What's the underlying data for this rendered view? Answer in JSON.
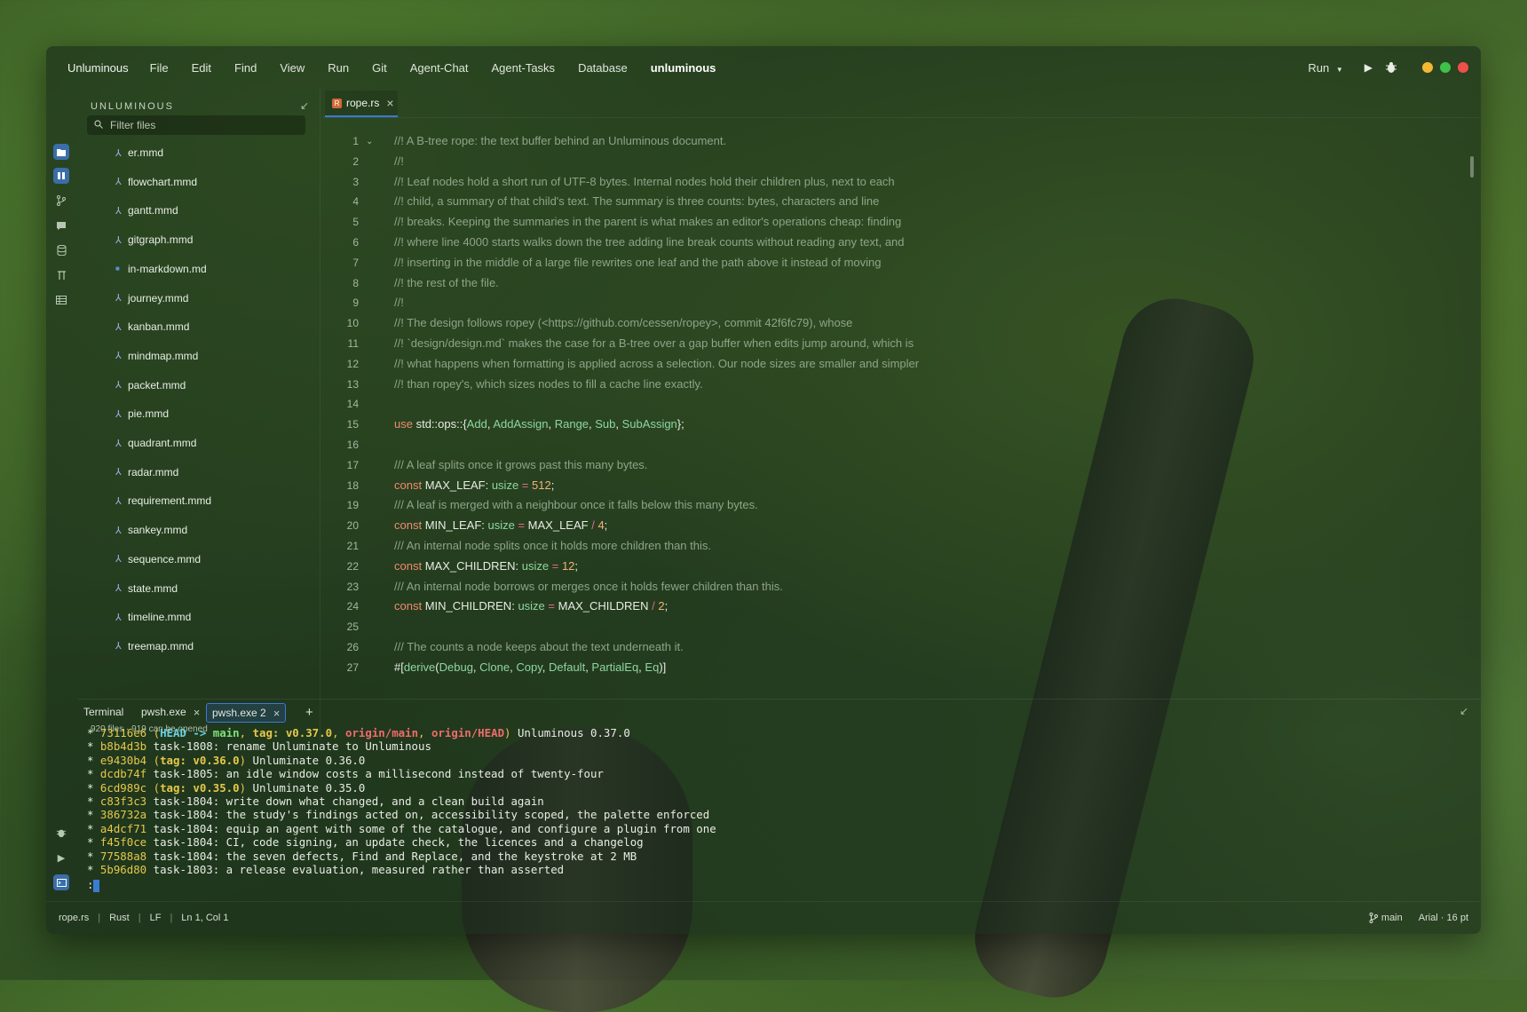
{
  "menubar": {
    "app_name": "Unluminous",
    "items": [
      "File",
      "Edit",
      "Find",
      "View",
      "Run",
      "Git",
      "Agent-Chat",
      "Agent-Tasks",
      "Database"
    ],
    "project": "unluminous",
    "run_label": "Run"
  },
  "window_controls": {
    "minimize_color": "#f5b731",
    "zoom_color": "#3fc24a",
    "close_color": "#f0504a"
  },
  "sidebar": {
    "title": "UNLUMINOUS",
    "filter_placeholder": "Filter files",
    "files": [
      {
        "name": "er.mmd",
        "icon": "diagram-icon"
      },
      {
        "name": "flowchart.mmd",
        "icon": "diagram-icon"
      },
      {
        "name": "gantt.mmd",
        "icon": "diagram-icon"
      },
      {
        "name": "gitgraph.mmd",
        "icon": "diagram-icon"
      },
      {
        "name": "in-markdown.md",
        "icon": "markdown-icon"
      },
      {
        "name": "journey.mmd",
        "icon": "diagram-icon"
      },
      {
        "name": "kanban.mmd",
        "icon": "diagram-icon"
      },
      {
        "name": "mindmap.mmd",
        "icon": "diagram-icon"
      },
      {
        "name": "packet.mmd",
        "icon": "diagram-icon"
      },
      {
        "name": "pie.mmd",
        "icon": "diagram-icon"
      },
      {
        "name": "quadrant.mmd",
        "icon": "diagram-icon"
      },
      {
        "name": "radar.mmd",
        "icon": "diagram-icon"
      },
      {
        "name": "requirement.mmd",
        "icon": "diagram-icon"
      },
      {
        "name": "sankey.mmd",
        "icon": "diagram-icon"
      },
      {
        "name": "sequence.mmd",
        "icon": "diagram-icon"
      },
      {
        "name": "state.mmd",
        "icon": "diagram-icon"
      },
      {
        "name": "timeline.mmd",
        "icon": "diagram-icon"
      },
      {
        "name": "treemap.mmd",
        "icon": "diagram-icon"
      }
    ],
    "footer": "920 files  ·  919 can be opened"
  },
  "editor": {
    "tab_label": "rope.rs",
    "lines": [
      {
        "n": "1",
        "fold": true,
        "segs": [
          [
            "cm",
            "//! A B-tree rope: the text buffer behind an Unluminous document."
          ]
        ]
      },
      {
        "n": "2",
        "segs": [
          [
            "cm",
            "//!"
          ]
        ]
      },
      {
        "n": "3",
        "segs": [
          [
            "cm",
            "//! Leaf nodes hold a short run of UTF-8 bytes. Internal nodes hold their children plus, next to each"
          ]
        ]
      },
      {
        "n": "4",
        "segs": [
          [
            "cm",
            "//! child, a summary of that child's text. The summary is three counts: bytes, characters and line"
          ]
        ]
      },
      {
        "n": "5",
        "segs": [
          [
            "cm",
            "//! breaks. Keeping the summaries in the parent is what makes an editor's operations cheap: finding"
          ]
        ]
      },
      {
        "n": "6",
        "segs": [
          [
            "cm",
            "//! where line 4000 starts walks down the tree adding line break counts without reading any text, and"
          ]
        ]
      },
      {
        "n": "7",
        "segs": [
          [
            "cm",
            "//! inserting in the middle of a large file rewrites one leaf and the path above it instead of moving"
          ]
        ]
      },
      {
        "n": "8",
        "segs": [
          [
            "cm",
            "//! the rest of the file."
          ]
        ]
      },
      {
        "n": "9",
        "segs": [
          [
            "cm",
            "//!"
          ]
        ]
      },
      {
        "n": "10",
        "segs": [
          [
            "cm",
            "//! The design follows ropey (<https://github.com/cessen/ropey>, commit 42f6fc79), whose"
          ]
        ]
      },
      {
        "n": "11",
        "segs": [
          [
            "cm",
            "//! `design/design.md` makes the case for a B-tree over a gap buffer when edits jump around, which is"
          ]
        ]
      },
      {
        "n": "12",
        "segs": [
          [
            "cm",
            "//! what happens when formatting is applied across a selection. Our node sizes are smaller and simpler"
          ]
        ]
      },
      {
        "n": "13",
        "segs": [
          [
            "cm",
            "//! than ropey's, which sizes nodes to fill a cache line exactly."
          ]
        ]
      },
      {
        "n": "14",
        "segs": []
      },
      {
        "n": "15",
        "segs": [
          [
            "kw",
            "use "
          ],
          [
            "tx",
            "std::ops::{"
          ],
          [
            "ty",
            "Add"
          ],
          [
            "tx",
            ", "
          ],
          [
            "ty",
            "AddAssign"
          ],
          [
            "tx",
            ", "
          ],
          [
            "ty",
            "Range"
          ],
          [
            "tx",
            ", "
          ],
          [
            "ty",
            "Sub"
          ],
          [
            "tx",
            ", "
          ],
          [
            "ty",
            "SubAssign"
          ],
          [
            "tx",
            "};"
          ]
        ]
      },
      {
        "n": "16",
        "segs": []
      },
      {
        "n": "17",
        "segs": [
          [
            "cm",
            "/// A leaf splits once it grows past this many bytes."
          ]
        ]
      },
      {
        "n": "18",
        "segs": [
          [
            "kw",
            "const "
          ],
          [
            "tx",
            "MAX_LEAF: "
          ],
          [
            "ty",
            "usize"
          ],
          [
            "op",
            " = "
          ],
          [
            "num",
            "512"
          ],
          [
            "tx",
            ";"
          ]
        ]
      },
      {
        "n": "19",
        "segs": [
          [
            "cm",
            "/// A leaf is merged with a neighbour once it falls below this many bytes."
          ]
        ]
      },
      {
        "n": "20",
        "segs": [
          [
            "kw",
            "const "
          ],
          [
            "tx",
            "MIN_LEAF: "
          ],
          [
            "ty",
            "usize"
          ],
          [
            "op",
            " = "
          ],
          [
            "tx",
            "MAX_LEAF "
          ],
          [
            "op",
            "/ "
          ],
          [
            "num",
            "4"
          ],
          [
            "tx",
            ";"
          ]
        ]
      },
      {
        "n": "21",
        "segs": [
          [
            "cm",
            "/// An internal node splits once it holds more children than this."
          ]
        ]
      },
      {
        "n": "22",
        "segs": [
          [
            "kw",
            "const "
          ],
          [
            "tx",
            "MAX_CHILDREN: "
          ],
          [
            "ty",
            "usize"
          ],
          [
            "op",
            " = "
          ],
          [
            "num",
            "12"
          ],
          [
            "tx",
            ";"
          ]
        ]
      },
      {
        "n": "23",
        "segs": [
          [
            "cm",
            "/// An internal node borrows or merges once it holds fewer children than this."
          ]
        ]
      },
      {
        "n": "24",
        "segs": [
          [
            "kw",
            "const "
          ],
          [
            "tx",
            "MIN_CHILDREN: "
          ],
          [
            "ty",
            "usize"
          ],
          [
            "op",
            " = "
          ],
          [
            "tx",
            "MAX_CHILDREN "
          ],
          [
            "op",
            "/ "
          ],
          [
            "num",
            "2"
          ],
          [
            "tx",
            ";"
          ]
        ]
      },
      {
        "n": "25",
        "segs": []
      },
      {
        "n": "26",
        "segs": [
          [
            "cm",
            "/// The counts a node keeps about the text underneath it."
          ]
        ]
      },
      {
        "n": "27",
        "segs": [
          [
            "tx",
            "#["
          ],
          [
            "mac",
            "derive"
          ],
          [
            "tx",
            "("
          ],
          [
            "ty",
            "Debug"
          ],
          [
            "tx",
            ", "
          ],
          [
            "ty",
            "Clone"
          ],
          [
            "tx",
            ", "
          ],
          [
            "ty",
            "Copy"
          ],
          [
            "tx",
            ", "
          ],
          [
            "ty",
            "Default"
          ],
          [
            "tx",
            ", "
          ],
          [
            "ty",
            "PartialEq"
          ],
          [
            "tx",
            ", "
          ],
          [
            "ty",
            "Eq"
          ],
          [
            "tx",
            ")]"
          ]
        ]
      }
    ]
  },
  "terminal": {
    "label": "Terminal",
    "tabs": [
      "pwsh.exe",
      "pwsh.exe 2"
    ],
    "log": [
      [
        [
          "star",
          "* "
        ],
        [
          "hash",
          "73116e6 "
        ],
        [
          "ref",
          "("
        ],
        [
          "head",
          "HEAD -> "
        ],
        [
          "main",
          "main"
        ],
        [
          "ref",
          ", "
        ],
        [
          "tag",
          "tag: v0.37.0"
        ],
        [
          "ref",
          ", "
        ],
        [
          "rem",
          "origin/main"
        ],
        [
          "ref",
          ", "
        ],
        [
          "rem",
          "origin/HEAD"
        ],
        [
          "ref",
          ")"
        ],
        [
          "txt",
          " Unluminous 0.37.0"
        ]
      ],
      [
        [
          "star",
          "* "
        ],
        [
          "hash",
          "b8b4d3b "
        ],
        [
          "txt",
          "task-1808: rename Unluminate to Unluminous"
        ]
      ],
      [
        [
          "star",
          "* "
        ],
        [
          "hash",
          "e9430b4 "
        ],
        [
          "ref",
          "("
        ],
        [
          "tag",
          "tag: v0.36.0"
        ],
        [
          "ref",
          ")"
        ],
        [
          "txt",
          " Unluminate 0.36.0"
        ]
      ],
      [
        [
          "star",
          "* "
        ],
        [
          "hash",
          "dcdb74f "
        ],
        [
          "txt",
          "task-1805: an idle window costs a millisecond instead of twenty-four"
        ]
      ],
      [
        [
          "star",
          "* "
        ],
        [
          "hash",
          "6cd989c "
        ],
        [
          "ref",
          "("
        ],
        [
          "tag",
          "tag: v0.35.0"
        ],
        [
          "ref",
          ")"
        ],
        [
          "txt",
          " Unluminate 0.35.0"
        ]
      ],
      [
        [
          "star",
          "* "
        ],
        [
          "hash",
          "c83f3c3 "
        ],
        [
          "txt",
          "task-1804: write down what changed, and a clean build again"
        ]
      ],
      [
        [
          "star",
          "* "
        ],
        [
          "hash",
          "386732a "
        ],
        [
          "txt",
          "task-1804: the study's findings acted on, accessibility scoped, the palette enforced"
        ]
      ],
      [
        [
          "star",
          "* "
        ],
        [
          "hash",
          "a4dcf71 "
        ],
        [
          "txt",
          "task-1804: equip an agent with some of the catalogue, and configure a plugin from one"
        ]
      ],
      [
        [
          "star",
          "* "
        ],
        [
          "hash",
          "f45f0ce "
        ],
        [
          "txt",
          "task-1804: CI, code signing, an update check, the licences and a changelog"
        ]
      ],
      [
        [
          "star",
          "* "
        ],
        [
          "hash",
          "77588a8 "
        ],
        [
          "txt",
          "task-1804: the seven defects, Find and Replace, and the keystroke at 2 MB"
        ]
      ],
      [
        [
          "star",
          "* "
        ],
        [
          "hash",
          "5b96d80 "
        ],
        [
          "txt",
          "task-1803: a release evaluation, measured rather than asserted"
        ]
      ]
    ],
    "prompt": ":"
  },
  "statusbar": {
    "file": "rope.rs",
    "language": "Rust",
    "eol": "LF",
    "position": "Ln 1, Col 1",
    "branch": "main",
    "font": "Arial · 16 pt"
  }
}
